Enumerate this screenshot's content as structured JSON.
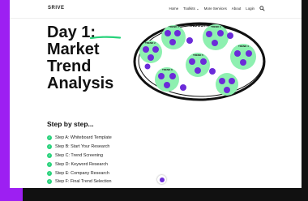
{
  "header": {
    "logo": "SRIVE",
    "nav": [
      "Home",
      "Toolkits ⌄",
      "More Services",
      "About",
      "Login"
    ]
  },
  "hero": {
    "title_line1": "Day 1:",
    "title_line2": "Market",
    "title_line3": "Trend",
    "title_line4": "Analysis"
  },
  "diagram": {
    "industry_label": "INDUSTRY",
    "trends": [
      "TREND 1",
      "TREND 2",
      "TREND 3",
      "TREND 4",
      "TREND 5",
      "TREND 6"
    ],
    "colors": {
      "trend_bubble": "#8ef0b0",
      "keyword_dot": "#6b2bd9",
      "outline": "#111111"
    }
  },
  "steps": {
    "heading": "Step by step...",
    "items": [
      "Step A: Whiteboard Template",
      "Step B: Start Your Research",
      "Step C: Trend Screening",
      "Step D: Keyword Research",
      "Step E: Company Research",
      "Step F: Final Trend Selection"
    ]
  },
  "colors": {
    "accent": "#27d27a",
    "purple_bg": "#9d1ff2",
    "underline": "#27d27a"
  }
}
